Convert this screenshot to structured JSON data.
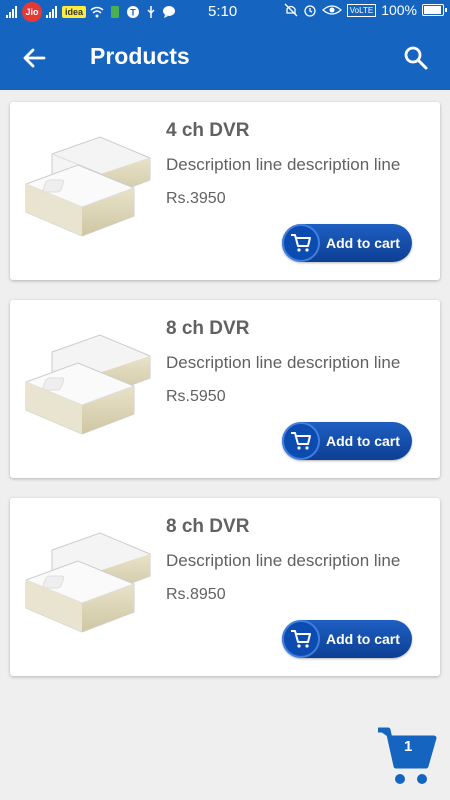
{
  "status_bar": {
    "carrier1": "Jio",
    "carrier2": "idea",
    "time": "5:10",
    "volte": "VoLTE",
    "battery": "100%",
    "battery_level": 1.0
  },
  "app_bar": {
    "title": "Products",
    "back_icon": "arrow-left-icon",
    "search_icon": "search-icon"
  },
  "products": [
    {
      "name": "4 ch DVR",
      "description": "Description line description line",
      "price": "Rs.3950",
      "button": "Add to cart"
    },
    {
      "name": "8 ch DVR",
      "description": "Description line description line",
      "price": "Rs.5950",
      "button": "Add to cart"
    },
    {
      "name": "8 ch DVR",
      "description": "Description line description line",
      "price": "Rs.8950",
      "button": "Add to cart"
    }
  ],
  "cart": {
    "count": "1",
    "icon": "shopping-cart-icon"
  },
  "colors": {
    "primary": "#1565c0",
    "button": "#0d47a1",
    "text": "#616161",
    "background": "#efefef"
  }
}
